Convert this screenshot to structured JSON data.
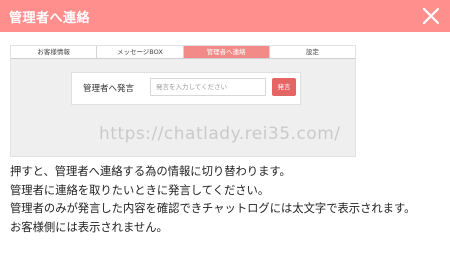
{
  "modal": {
    "title": "管理者へ連絡",
    "close_icon": "close-icon",
    "header_color": "#fe8f8d"
  },
  "preview": {
    "tabs": [
      {
        "label": "お客様情報",
        "active": false
      },
      {
        "label": "メッセージBOX",
        "active": false
      },
      {
        "label": "管理者へ連絡",
        "active": true
      },
      {
        "label": "設定",
        "active": false
      }
    ],
    "post_label": "管理者へ発言",
    "input_placeholder": "発言を入力してください",
    "post_button": "発言",
    "watermark": "https://chatlady.rei35.com/"
  },
  "description": [
    "押すと、管理者へ連絡する為の情報に切り替わります。",
    "管理者に連絡を取りたいときに発言してください。",
    "管理者のみが発言した内容を確認できチャットログには太文字で表示されます。",
    "お客様側には表示されません。"
  ]
}
